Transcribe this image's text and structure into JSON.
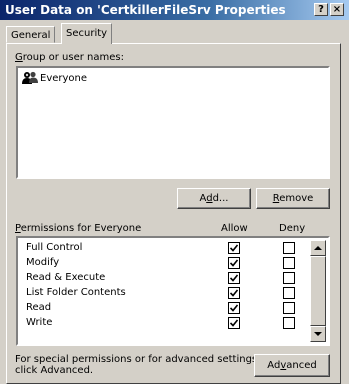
{
  "window": {
    "title": "User Data on 'CertkillerFileSrv Properties",
    "help_glyph": "?",
    "close_glyph": "×"
  },
  "tabs": [
    {
      "label": "General",
      "selected": false
    },
    {
      "label": "Security",
      "selected": true
    }
  ],
  "group_section": {
    "label_prefix": "G",
    "label_rest": "roup or user names:",
    "users": [
      {
        "name": "Everyone",
        "icon": "users-group-icon",
        "selected": true
      }
    ]
  },
  "buttons": {
    "add_a": "A",
    "add_u": "d",
    "add_b": "d...",
    "remove_u": "R",
    "remove_rest": "emove",
    "advanced_a": "Ad",
    "advanced_u": "v",
    "advanced_b": "anced"
  },
  "permissions": {
    "label_u": "P",
    "label_rest": "ermissions for Everyone",
    "allow_header": "Allow",
    "deny_header": "Deny",
    "rows": [
      {
        "name": "Full Control",
        "allow": true,
        "deny": false
      },
      {
        "name": "Modify",
        "allow": true,
        "deny": false
      },
      {
        "name": "Read & Execute",
        "allow": true,
        "deny": false
      },
      {
        "name": "List Folder Contents",
        "allow": true,
        "deny": false
      },
      {
        "name": "Read",
        "allow": true,
        "deny": false
      },
      {
        "name": "Write",
        "allow": true,
        "deny": false
      }
    ]
  },
  "footer": {
    "line1": "For special permissions or for advanced settings,",
    "line2": "click Advanced."
  },
  "colors": {
    "dialog_bg": "#d4d0c8",
    "title_start": "#0a246a",
    "title_end": "#a6caf0",
    "checkmark": "#000000"
  }
}
